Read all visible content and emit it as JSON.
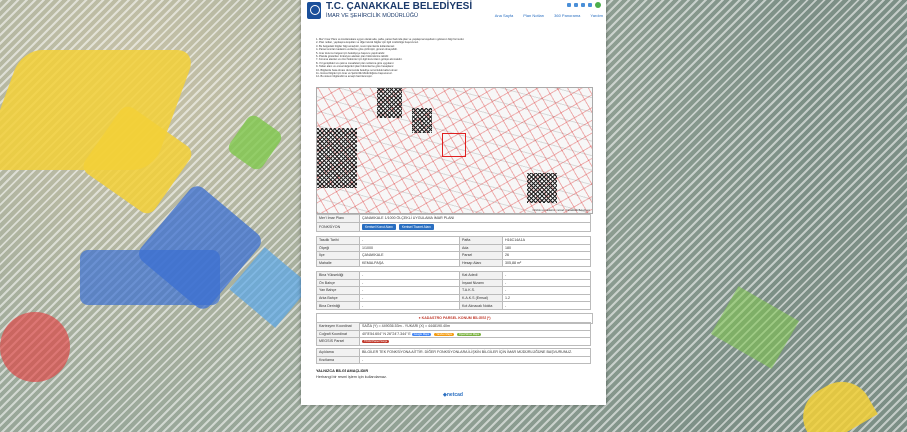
{
  "header": {
    "title": "T.C. ÇANAKKALE BELEDİYESİ",
    "subtitle": "İMAR VE ŞEHİRCİLİK MÜDÜRLÜĞÜ",
    "nav": [
      "Ana Sayfa",
      "Plan Notları",
      "360 Panorama",
      "Yardım"
    ]
  },
  "intro": {
    "lines": [
      "1- Mer'i İmar Planı ve kısıtlamalara uygun olarak ada, pafta, parsel bazında plan ve yapılaşma koşullarını gösteren bilgi formudur.",
      "2- Plan notları, yapılaşma koşulları ve diğer teknik bilgiler için ilgili müdürlüğe başvurunuz.",
      "3- Bu belgedeki bilgiler bilgi amaçlıdır, resmi işlemlerde kullanılamaz.",
      "4- Parsel sınırları kadastro verilerine göre çizilmiştir, güncel olmayabilir.",
      "5- İmar durumu belgesi için belediyeye başvuru yapılmalıdır.",
      "6- Planda gösterilen fonksiyon alanları plan hükümlerine tabidir.",
      "7- Koruma alanları ve özel hükümler için ilgili kurumların görüşü alınmalıdır.",
      "8- Yol genişlikleri ve çekme mesafeleri plan notlarına göre uygulanır.",
      "9- Taban alanı ve emsal değerleri plan hükümlerine göre hesaplanır.",
      "10- Bilgilerde hata olması durumunda belediye sorumluluk kabul etmez.",
      "11- Güncel bilgiler için İmar ve Şehircilik Müdürlüğüne başvurunuz.",
      "12- Bu sistem bilgilendirme amaçlı hazırlanmıştır."
    ]
  },
  "map": {
    "credit": "Ortofoto ve kadastro: netcad / Çanakkale Belediyesi"
  },
  "plan_table": {
    "rows": [
      {
        "label": "Mer'i İmar Planı",
        "value": "ÇANAKKALE 1/1000 ÖLÇEKLİ UYGULAMA İMAR PLANI"
      },
      {
        "label": "FONKSİYON",
        "buttons": [
          "Kentsel Konut Alanı",
          "Kentsel Ticaret Alanı"
        ]
      }
    ]
  },
  "parcel_left": [
    {
      "label": "Tasdik Tarihi",
      "value": "-"
    },
    {
      "label": "Ölçeği",
      "value": "1/1000"
    },
    {
      "label": "İlçe",
      "value": "ÇANAKKALE"
    },
    {
      "label": "Mahalle",
      "value": "KEMALPAŞA"
    }
  ],
  "parcel_right": [
    {
      "label": "Pafta",
      "value": "H16C14A1A"
    },
    {
      "label": "Ada",
      "value": "180"
    },
    {
      "label": "Parsel",
      "value": "26"
    },
    {
      "label": "Hesap Alanı",
      "value": "305,88 m²"
    }
  ],
  "build_left": [
    {
      "label": "Bina Yüksekliği",
      "value": "-"
    },
    {
      "label": "Ön Bahçe",
      "value": "-"
    },
    {
      "label": "Yan Bahçe",
      "value": "-"
    },
    {
      "label": "Arka Bahçe",
      "value": "-"
    },
    {
      "label": "Bina Derinliği",
      "value": "-"
    }
  ],
  "build_right": [
    {
      "label": "Kat Adedi",
      "value": "-"
    },
    {
      "label": "İnşaat Nizamı",
      "value": "-"
    },
    {
      "label": "T.A.K.S.",
      "value": "-"
    },
    {
      "label": "K.A.K.S (Emsal)",
      "value": "1.2"
    },
    {
      "label": "Kot Alınacak Nokta",
      "value": "-"
    }
  ],
  "kadastro": {
    "title": "KADASTRO PARSEL KONUM BİLGİSİ (*)",
    "rows": [
      {
        "label": "Kartezyen Koordinat",
        "value": "SAĞA (Y) = 449036.53m - YUKARI (X) = 4448190.40m"
      },
      {
        "label": "Coğrafi Koordinat",
        "value": "40°8'54.604\" N 26°24'7.344\" E"
      },
      {
        "label": "MEGSİS Parsel",
        "value": ""
      }
    ],
    "chips": [
      "Google Maps",
      "Yandex Maps",
      "OpenStreet Maps"
    ],
    "megsis_chip": "TKGM Parsel Sorgu",
    "chip_colors": {
      "google": "#4285f4",
      "yandex": "#f39c12",
      "osm": "#7cb342",
      "tkgm": "#c0392b"
    }
  },
  "aciklama": {
    "rows": [
      {
        "label": "Açıklama",
        "value": "BİLGİLER TEK FONKSİYONA AİTTİR. DİĞER FONKSİYONLARA İLİŞKİN BİLGİLER İÇİN İMAR MÜDÜRLÜĞÜNE BAŞVURUNUZ."
      },
      {
        "label": "Kısıtlama",
        "value": "-"
      }
    ]
  },
  "note": {
    "title": "YALNIZCA BİLGİ AMAÇLIDIR",
    "body": "Herhangi bir resmi işlem için kullanılamaz."
  },
  "footer": {
    "brand": "netcad"
  },
  "colors": {
    "accent": "#2a6fc1",
    "title": "#1b3a6b",
    "warning": "#c0392b"
  }
}
